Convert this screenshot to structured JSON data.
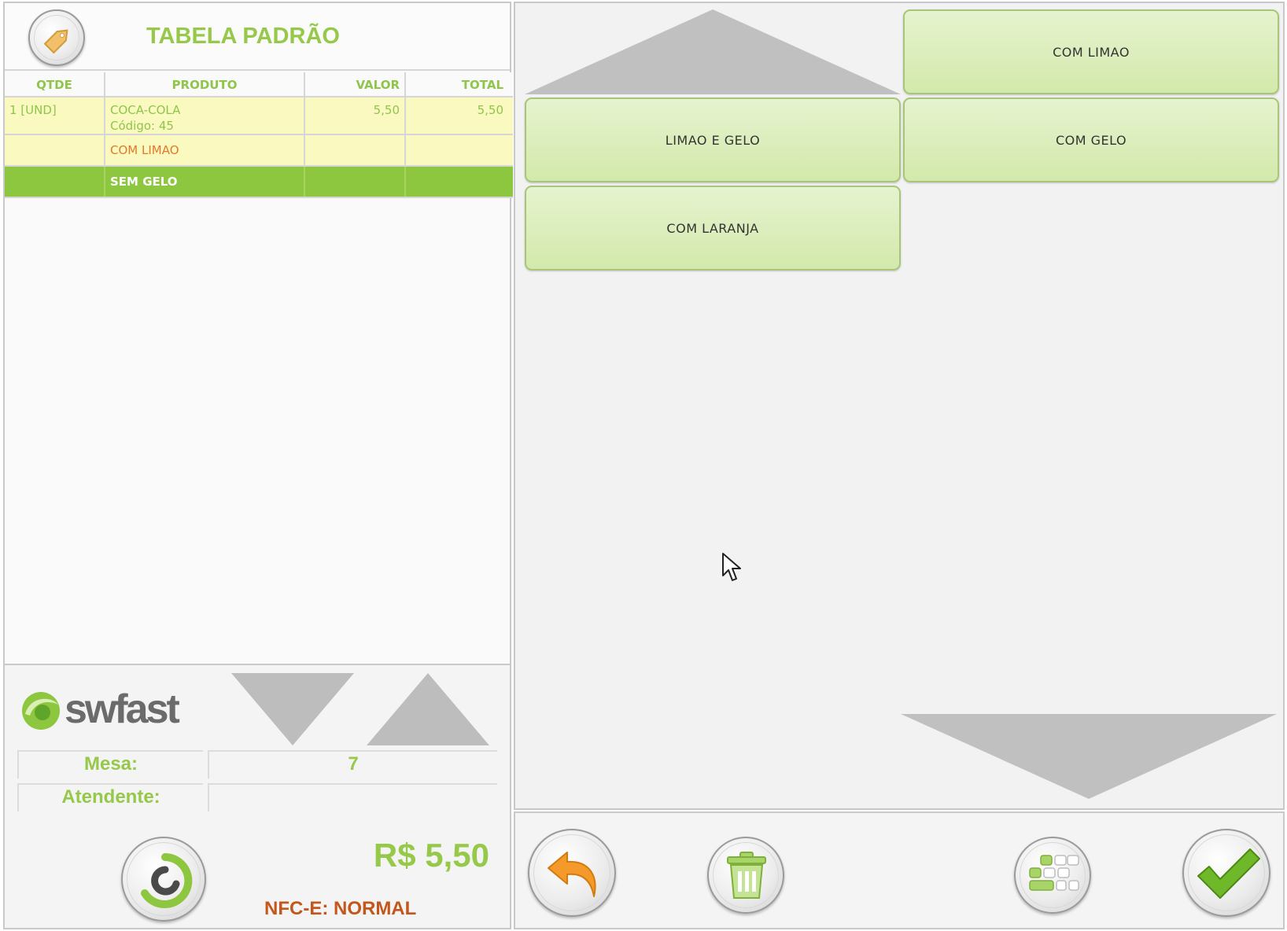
{
  "header": {
    "title": "TABELA PADRÃO",
    "tag_icon": "price-tag-icon"
  },
  "order_grid": {
    "columns": [
      "QTDE",
      "PRODUTO",
      "VALOR",
      "TOTAL"
    ],
    "item": {
      "qtde": "1 [UND]",
      "produto": "COCA-COLA",
      "codigo": "Código: 45",
      "valor": "5,50",
      "total": "5,50"
    },
    "modifiers": [
      {
        "label": "COM LIMAO",
        "selected": false
      },
      {
        "label": "SEM GELO",
        "selected": true
      }
    ]
  },
  "footer": {
    "logo_text": "swfast",
    "mesa_label": "Mesa:",
    "mesa_value": "7",
    "atendente_label": "Atendente:",
    "atendente_value": "",
    "total": "R$ 5,50",
    "nfce_status": "NFC-E: NORMAL"
  },
  "options": [
    "COM LIMAO",
    "LIMAO E GELO",
    "COM GELO",
    "COM LARANJA"
  ],
  "actions": {
    "back_icon": "undo-arrow-icon",
    "delete_icon": "trash-icon",
    "keyboard_icon": "keyboard-icon",
    "confirm_icon": "checkmark-icon"
  },
  "colors": {
    "brand_green": "#8dc63f",
    "title_green": "#96c84a",
    "item_row_bg": "#fafac0",
    "modifier_text": "#e07a2a",
    "nfce_text": "#c4561c",
    "option_button": "#d3e9ab"
  }
}
